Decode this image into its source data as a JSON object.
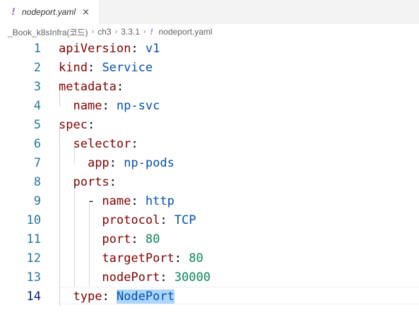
{
  "tab": {
    "icon": "!",
    "label": "nodeport.yaml",
    "close": "×"
  },
  "breadcrumb": {
    "items": [
      "_Book_k8sInfra(코드)",
      "ch3",
      "3.3.1"
    ],
    "separator": "›",
    "file_icon": "!",
    "file": "nodeport.yaml"
  },
  "editor": {
    "active_line": 14,
    "lines": [
      {
        "num": "1",
        "indent": "",
        "key": "apiVersion",
        "colon": ":",
        "value": " v1",
        "vtype": "str"
      },
      {
        "num": "2",
        "indent": "",
        "key": "kind",
        "colon": ":",
        "value": " Service",
        "vtype": "str"
      },
      {
        "num": "3",
        "indent": "",
        "key": "metadata",
        "colon": ":",
        "value": "",
        "vtype": "str"
      },
      {
        "num": "4",
        "indent": "  ",
        "key": "name",
        "colon": ":",
        "value": " np-svc",
        "vtype": "str"
      },
      {
        "num": "5",
        "indent": "",
        "key": "spec",
        "colon": ":",
        "value": "",
        "vtype": "str"
      },
      {
        "num": "6",
        "indent": "  ",
        "key": "selector",
        "colon": ":",
        "value": "",
        "vtype": "str"
      },
      {
        "num": "7",
        "indent": "    ",
        "key": "app",
        "colon": ":",
        "value": " np-pods",
        "vtype": "str"
      },
      {
        "num": "8",
        "indent": "  ",
        "key": "ports",
        "colon": ":",
        "value": "",
        "vtype": "str"
      },
      {
        "num": "9",
        "indent": "    - ",
        "key": "name",
        "colon": ":",
        "value": " http",
        "vtype": "str"
      },
      {
        "num": "10",
        "indent": "      ",
        "key": "protocol",
        "colon": ":",
        "value": " TCP",
        "vtype": "str"
      },
      {
        "num": "11",
        "indent": "      ",
        "key": "port",
        "colon": ":",
        "value": " 80",
        "vtype": "num"
      },
      {
        "num": "12",
        "indent": "      ",
        "key": "targetPort",
        "colon": ":",
        "value": " 80",
        "vtype": "num"
      },
      {
        "num": "13",
        "indent": "      ",
        "key": "nodePort",
        "colon": ":",
        "value": " 30000",
        "vtype": "num"
      },
      {
        "num": "14",
        "indent": "  ",
        "key": "type",
        "colon": ":",
        "value": " NodePort",
        "vtype": "str",
        "selected": "NodePort"
      }
    ]
  }
}
